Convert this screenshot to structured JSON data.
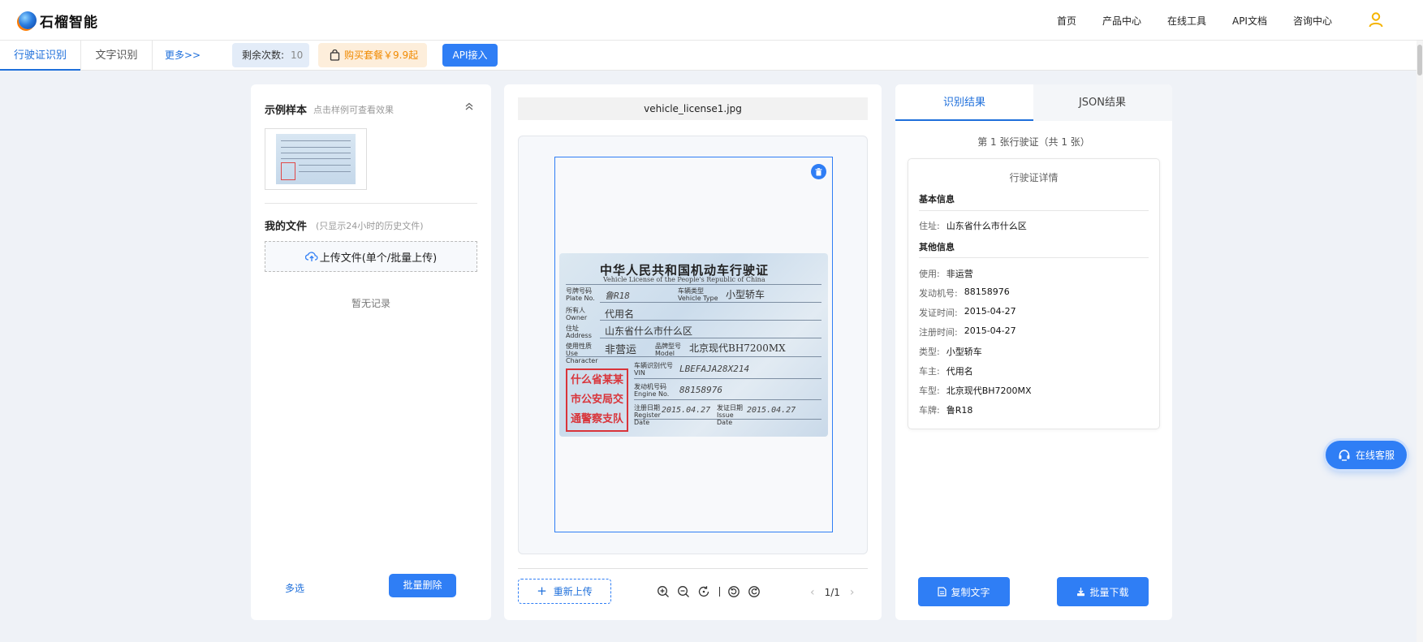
{
  "app": {
    "logo_text": "石榴智能"
  },
  "nav": {
    "items": [
      "首页",
      "产品中心",
      "在线工具",
      "API文档",
      "咨询中心"
    ]
  },
  "tabs": {
    "items": [
      "行驶证识别",
      "文字识别"
    ],
    "more": "更多>>"
  },
  "quota": {
    "label": "剩余次数:",
    "value": "10"
  },
  "buy": {
    "label": "购买套餐￥9.9起"
  },
  "api_button": "API接入",
  "left": {
    "sample_title": "示例样本",
    "sample_hint": "点击样例可查看效果",
    "files_title": "我的文件",
    "files_hint": "(只显示24小时的历史文件)",
    "upload_label": "上传文件(单个/批量上传)",
    "empty_text": "暂无记录",
    "multi_select": "多选",
    "batch_delete": "批量删除"
  },
  "middle": {
    "filename": "vehicle_license1.jpg",
    "reupload": "重新上传",
    "page_indicator": "1/1",
    "license": {
      "title": "中华人民共和国机动车行驶证",
      "subtitle": "Vehicle License of the People's Republic of China",
      "plate_label": "号牌号码 Plate No.",
      "plate_value": "鲁R18",
      "type_label": "车辆类型 Vehicle Type",
      "type_value": "小型轿车",
      "owner_label": "所有人 Owner",
      "owner_value": "代用名",
      "address_label": "住址 Address",
      "address_value": "山东省什么市什么区",
      "use_label": "使用性质 Use Character",
      "use_value": "非营运",
      "model_label": "品牌型号 Model",
      "model_value": "北京现代BH7200MX",
      "vin_label": "车辆识别代号 VIN",
      "vin_value": "LBEFAJA28X214",
      "engine_label": "发动机号码 Engine No.",
      "engine_value": "88158976",
      "reg_label": "注册日期 Register Date",
      "reg_value": "2015.04.27",
      "issue_label": "发证日期 Issue Date",
      "issue_value": "2015.04.27",
      "stamp_lines": [
        "什么省某某",
        "市公安局交",
        "通警察支队"
      ]
    }
  },
  "right": {
    "tabs": [
      "识别结果",
      "JSON结果"
    ],
    "count_line": "第 1 张行驶证（共 1 张）",
    "card_title": "行驶证详情",
    "basic_group": "基本信息",
    "basic_rows": [
      {
        "k": "住址:",
        "v": "山东省什么市什么区"
      }
    ],
    "other_group": "其他信息",
    "other_rows": [
      {
        "k": "使用:",
        "v": "非运营"
      },
      {
        "k": "发动机号:",
        "v": "88158976"
      },
      {
        "k": "发证时间:",
        "v": "2015-04-27"
      },
      {
        "k": "注册时间:",
        "v": "2015-04-27"
      },
      {
        "k": "类型:",
        "v": "小型轿车"
      },
      {
        "k": "车主:",
        "v": "代用名"
      },
      {
        "k": "车型:",
        "v": "北京现代BH7200MX"
      },
      {
        "k": "车牌:",
        "v": "鲁R18"
      }
    ],
    "copy_button": "复制文字",
    "download_button": "批量下载"
  },
  "service_button": "在线客服",
  "colors": {
    "accent": "#2f7ef5",
    "link": "#1e6fdb",
    "buy_text": "#f08a00",
    "buy_bg": "#fdeedb",
    "stamp": "#d9343a"
  }
}
